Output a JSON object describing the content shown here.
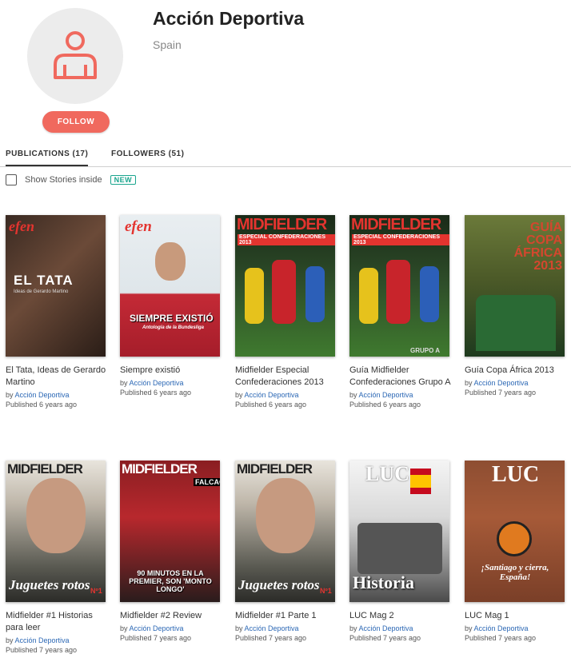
{
  "profile": {
    "name": "Acción Deportiva",
    "location": "Spain",
    "follow_label": "FOLLOW",
    "avatar_icon": "user-icon",
    "accent_color": "#f0695e"
  },
  "tabs": [
    {
      "label": "PUBLICATIONS (17)",
      "active": true
    },
    {
      "label": "FOLLOWERS (51)",
      "active": false
    }
  ],
  "stories": {
    "label": "Show Stories inside",
    "badge": "NEW",
    "checked": false
  },
  "publications": [
    {
      "title": "El Tata, Ideas de Gerardo Martino",
      "by": "by",
      "author": "Acción Deportiva",
      "published": "Published 6 years ago",
      "cover": {
        "brand": "efen",
        "headline": "EL TATA",
        "subline": "Ideas de Gerardo Martino"
      }
    },
    {
      "title": "Siempre existió",
      "by": "by",
      "author": "Acción Deportiva",
      "published": "Published 6 years ago",
      "cover": {
        "brand": "efen",
        "headline": "SIEMPRE EXISTIÓ",
        "subline": "Antología de la Bundesliga"
      }
    },
    {
      "title": "Midfielder Especial Confederaciones 2013",
      "by": "by",
      "author": "Acción Deportiva",
      "published": "Published 6 years ago",
      "cover": {
        "brand": "MIDFIELDER",
        "headline": "ESPECIAL CONFEDERACIONES 2013",
        "subline": ""
      }
    },
    {
      "title": "Guía Midfielder Confederaciones Grupo A",
      "by": "by",
      "author": "Acción Deportiva",
      "published": "Published 6 years ago",
      "cover": {
        "brand": "MIDFIELDER",
        "headline": "ESPECIAL CONFEDERACIONES 2013",
        "subline": "GRUPO A"
      }
    },
    {
      "title": "Guía Copa África 2013",
      "by": "by",
      "author": "Acción Deportiva",
      "published": "Published 7 years ago",
      "cover": {
        "brand": "",
        "headline": "GUÍA COPA ÁFRICA 2013",
        "subline": ""
      }
    },
    {
      "title": "Midfielder #1 Historias para leer",
      "by": "by",
      "author": "Acción Deportiva",
      "published": "Published 7 years ago",
      "cover": {
        "brand": "MIDFIELDER",
        "headline": "Juguetes rotos",
        "subline": "Nº1"
      }
    },
    {
      "title": "Midfielder #2 Review",
      "by": "by",
      "author": "Acción Deportiva",
      "published": "Published 7 years ago",
      "cover": {
        "brand": "MIDFIELDER",
        "headline": "90 MINUTOS EN LA PREMIER, SON 'MONTO LONGO'",
        "subline": "FALCAO"
      }
    },
    {
      "title": "Midfielder #1 Parte 1",
      "by": "by",
      "author": "Acción Deportiva",
      "published": "Published 7 years ago",
      "cover": {
        "brand": "MIDFIELDER",
        "headline": "Juguetes rotos",
        "subline": "Nº1"
      }
    },
    {
      "title": "LUC Mag 2",
      "by": "by",
      "author": "Acción Deportiva",
      "published": "Published 7 years ago",
      "cover": {
        "brand": "LUC",
        "headline": "Historia",
        "subline": ""
      }
    },
    {
      "title": "LUC Mag 1",
      "by": "by",
      "author": "Acción Deportiva",
      "published": "Published 7 years ago",
      "cover": {
        "brand": "LUC",
        "headline": "¡Santiago y cierra, España!",
        "subline": ""
      }
    }
  ]
}
